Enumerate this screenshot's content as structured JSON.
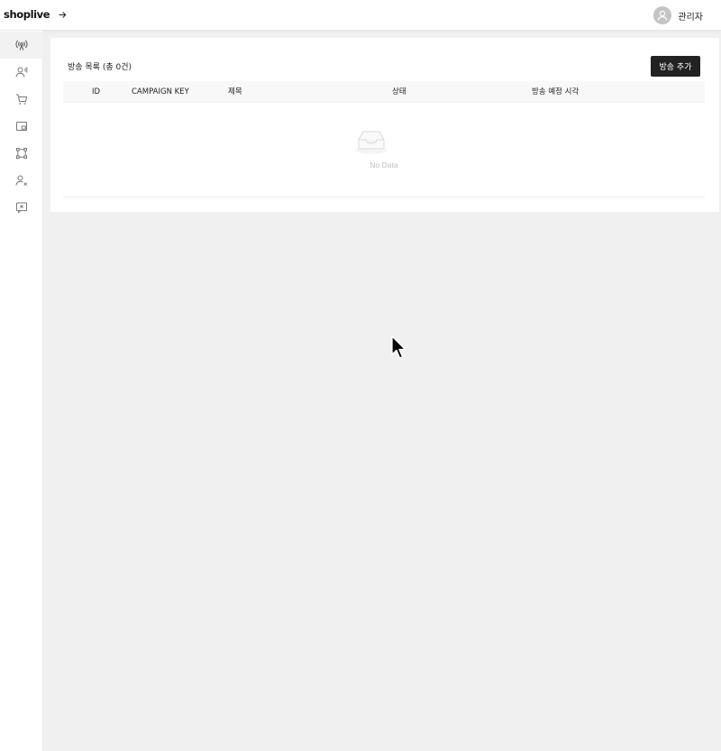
{
  "header": {
    "logo": "shoplive",
    "user_name": "관리자"
  },
  "sidebar": {
    "items": [
      {
        "icon": "broadcast-icon",
        "active": true
      },
      {
        "icon": "user-voice-icon",
        "active": false
      },
      {
        "icon": "cart-icon",
        "active": false
      },
      {
        "icon": "picture-in-picture-icon",
        "active": false
      },
      {
        "icon": "nodes-icon",
        "active": false
      },
      {
        "icon": "user-block-icon",
        "active": false
      },
      {
        "icon": "message-block-icon",
        "active": false
      }
    ]
  },
  "main": {
    "title": "방송 목록 (총 0건)",
    "add_button_label": "방송 추가",
    "table": {
      "columns": [
        "ID",
        "CAMPAIGN KEY",
        "제목",
        "상태",
        "방송 예정 시각"
      ],
      "rows": [],
      "empty_text": "No Data"
    }
  },
  "colors": {
    "primary_button": "#222222",
    "background": "#f0f0f0",
    "panel": "#ffffff"
  }
}
